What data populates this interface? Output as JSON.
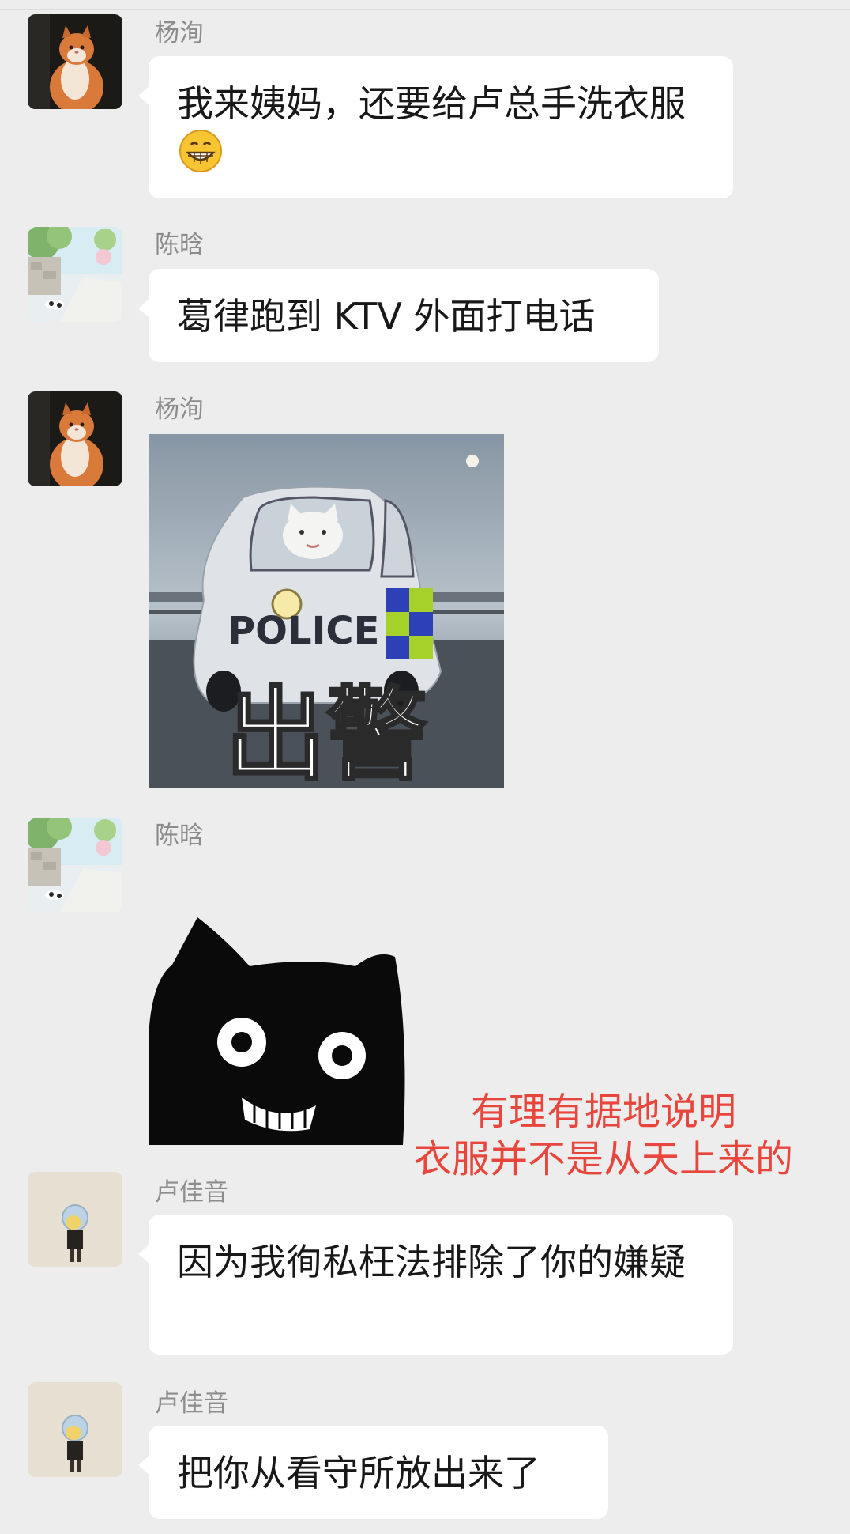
{
  "messages": [
    {
      "sender": "杨洵",
      "text": "我来姨妈，还要给卢总手洗衣服",
      "emoji": "grinning-face"
    },
    {
      "sender": "陈晗",
      "text": "葛律跑到 KTV 外面打电话"
    },
    {
      "sender": "杨洵",
      "sticker": {
        "icon": "police-car-cat-sticker",
        "logo_text": "POLICE",
        "caption": "出警"
      }
    },
    {
      "sender": "陈晗",
      "sticker": {
        "icon": "grinning-black-cat-sticker"
      }
    },
    {
      "sender": "卢佳音",
      "text": "因为我徇私枉法排除了你的嫌疑"
    },
    {
      "sender": "卢佳音",
      "text": "把你从看守所放出来了"
    }
  ],
  "annotation": {
    "line1": "有理有据地说明",
    "line2": "衣服并不是从天上来的",
    "color": "#e8453c"
  },
  "colors": {
    "background": "#ededed",
    "bubble": "#ffffff",
    "sender_name": "#8c8c8c",
    "text": "#181818"
  }
}
